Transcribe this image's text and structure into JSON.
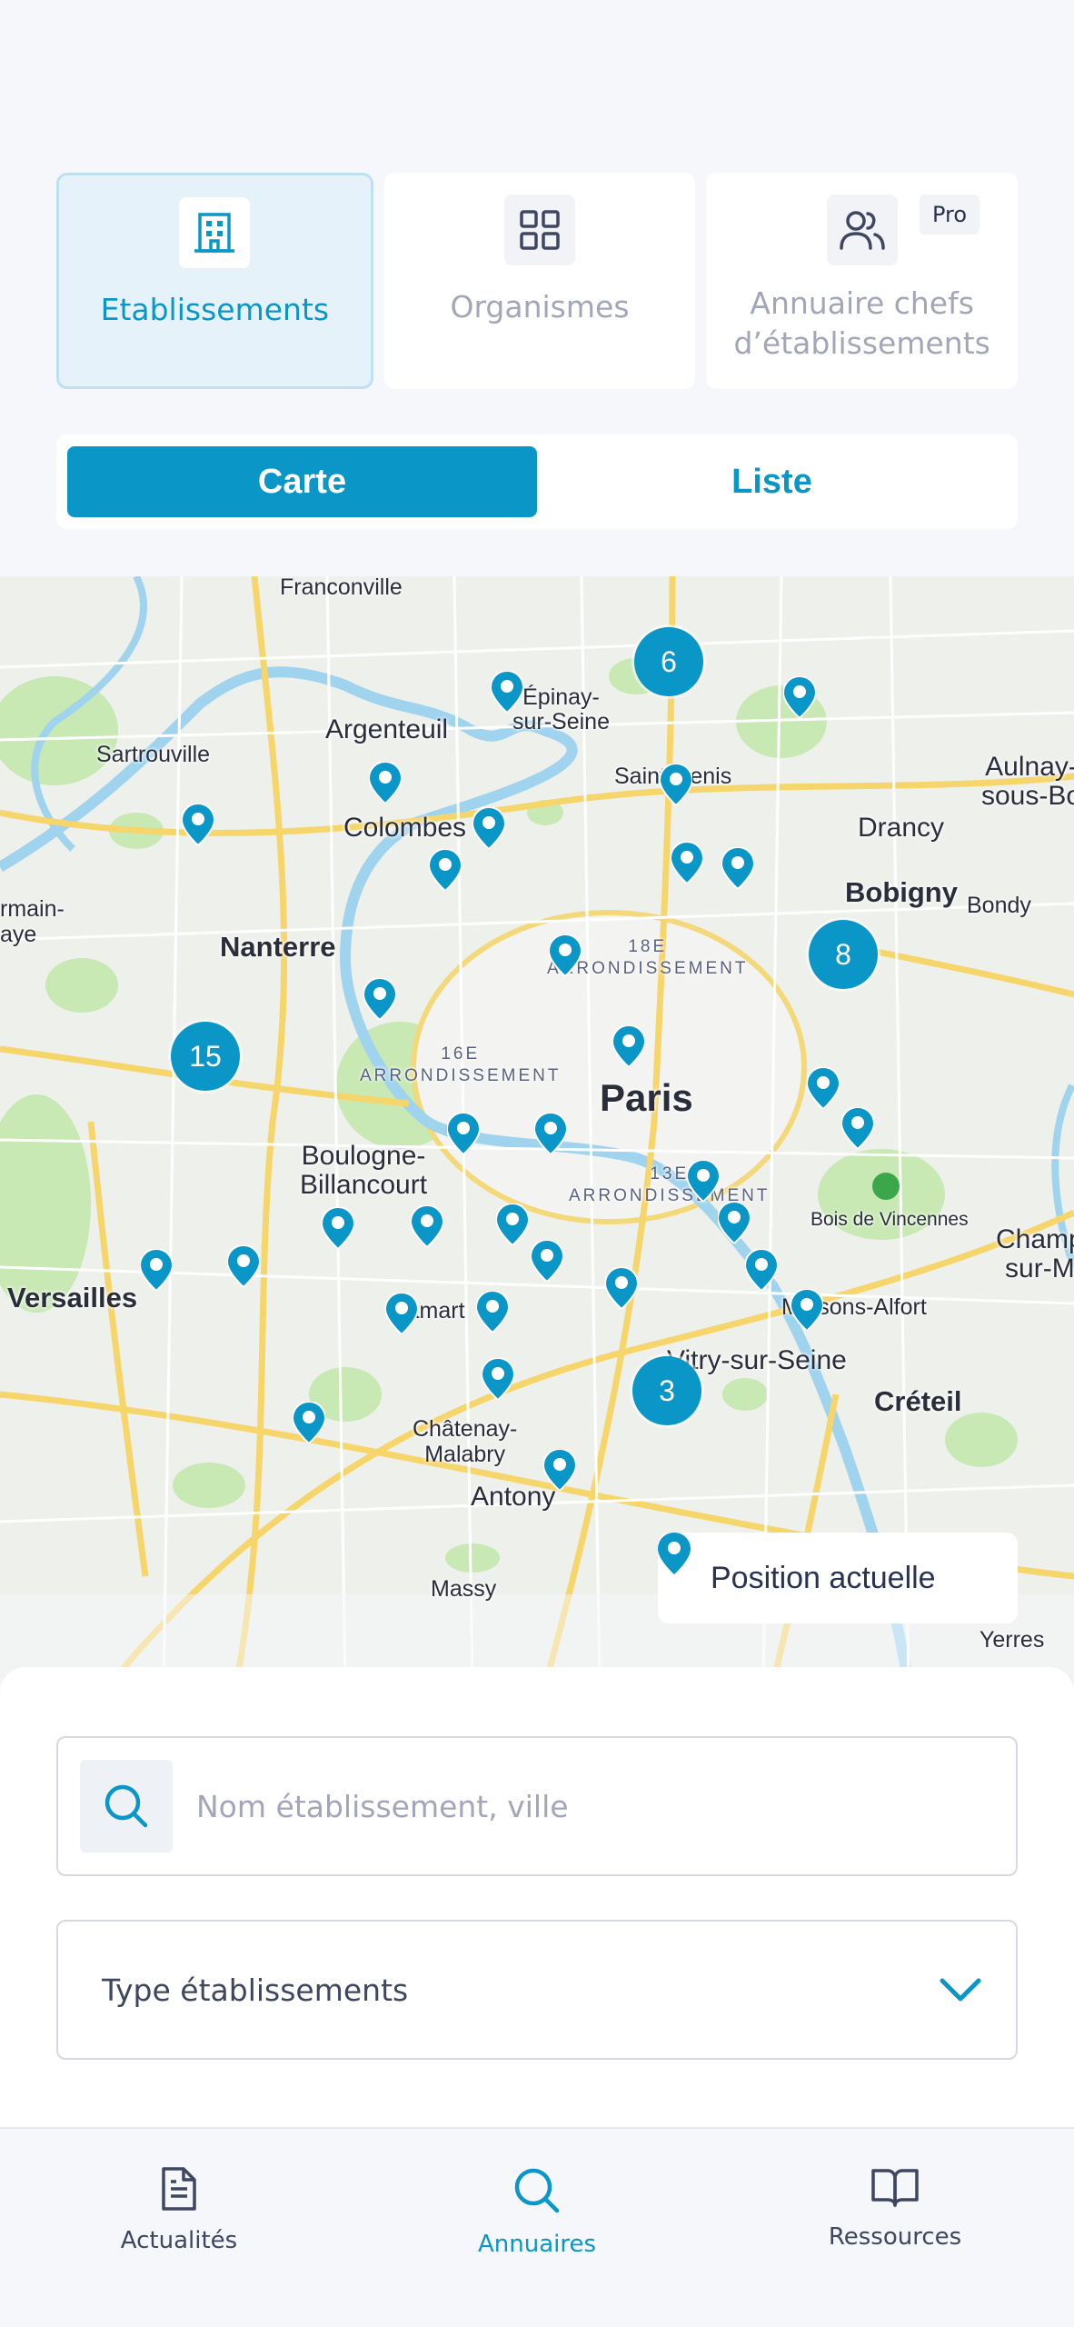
{
  "categories": [
    {
      "label": "Etablissements",
      "icon": "building-icon",
      "active": true
    },
    {
      "label": "Organismes",
      "icon": "grid-icon",
      "active": false
    },
    {
      "label": "Annuaire chefs d’établissements",
      "icon": "users-icon",
      "active": false,
      "badge": "Pro"
    }
  ],
  "view_toggle": {
    "map_label": "Carte",
    "list_label": "Liste",
    "selected": "Carte"
  },
  "map": {
    "labels": {
      "franconville": "Franconville",
      "epinay": "Épinay-\nsur-Seine",
      "argenteuil": "Argenteuil",
      "sartrouville": "Sartrouville",
      "colombes": "Colombes",
      "saint_denis": "Saint-Denis",
      "drancy": "Drancy",
      "aulnay": "Aulnay-\nsous-Bo",
      "bobigny": "Bobigny",
      "bondy": "Bondy",
      "germain": "rmain-\naye",
      "nanterre": "Nanterre",
      "arr18": "18E\nARRONDISSEMENT",
      "arr16": "16E\nARRONDISSEMENT",
      "paris": "Paris",
      "boulogne": "Boulogne-\nBillancourt",
      "arr13": "13E\nARRONDISSEMENT",
      "bois_vincennes": "Bois de Vincennes",
      "champigny": "Champ\nsur-M",
      "versailles": "Versailles",
      "clamart": "Clamart",
      "maisons_alfort": "Maisons-Alfort",
      "vitry": "Vitry-sur-Seine",
      "creteil": "Créteil",
      "chatenay": "Châtenay-\nMalabry",
      "antony": "Antony",
      "massy": "Massy",
      "yerres": "Yerres"
    },
    "clusters": [
      6,
      8,
      15,
      3
    ],
    "current_position_label": "Position actuelle"
  },
  "search": {
    "placeholder": "Nom établissement, ville",
    "value": ""
  },
  "type_select": {
    "label": "Type établissements"
  },
  "nav": [
    {
      "label": "Actualités",
      "icon": "document-icon",
      "active": false
    },
    {
      "label": "Annuaires",
      "icon": "search-icon",
      "active": true
    },
    {
      "label": "Ressources",
      "icon": "book-icon",
      "active": false
    }
  ],
  "colors": {
    "accent": "#0a97c8",
    "active_card_bg": "#e6f2f9",
    "text": "#3f4660",
    "muted": "#a3a6b9"
  }
}
